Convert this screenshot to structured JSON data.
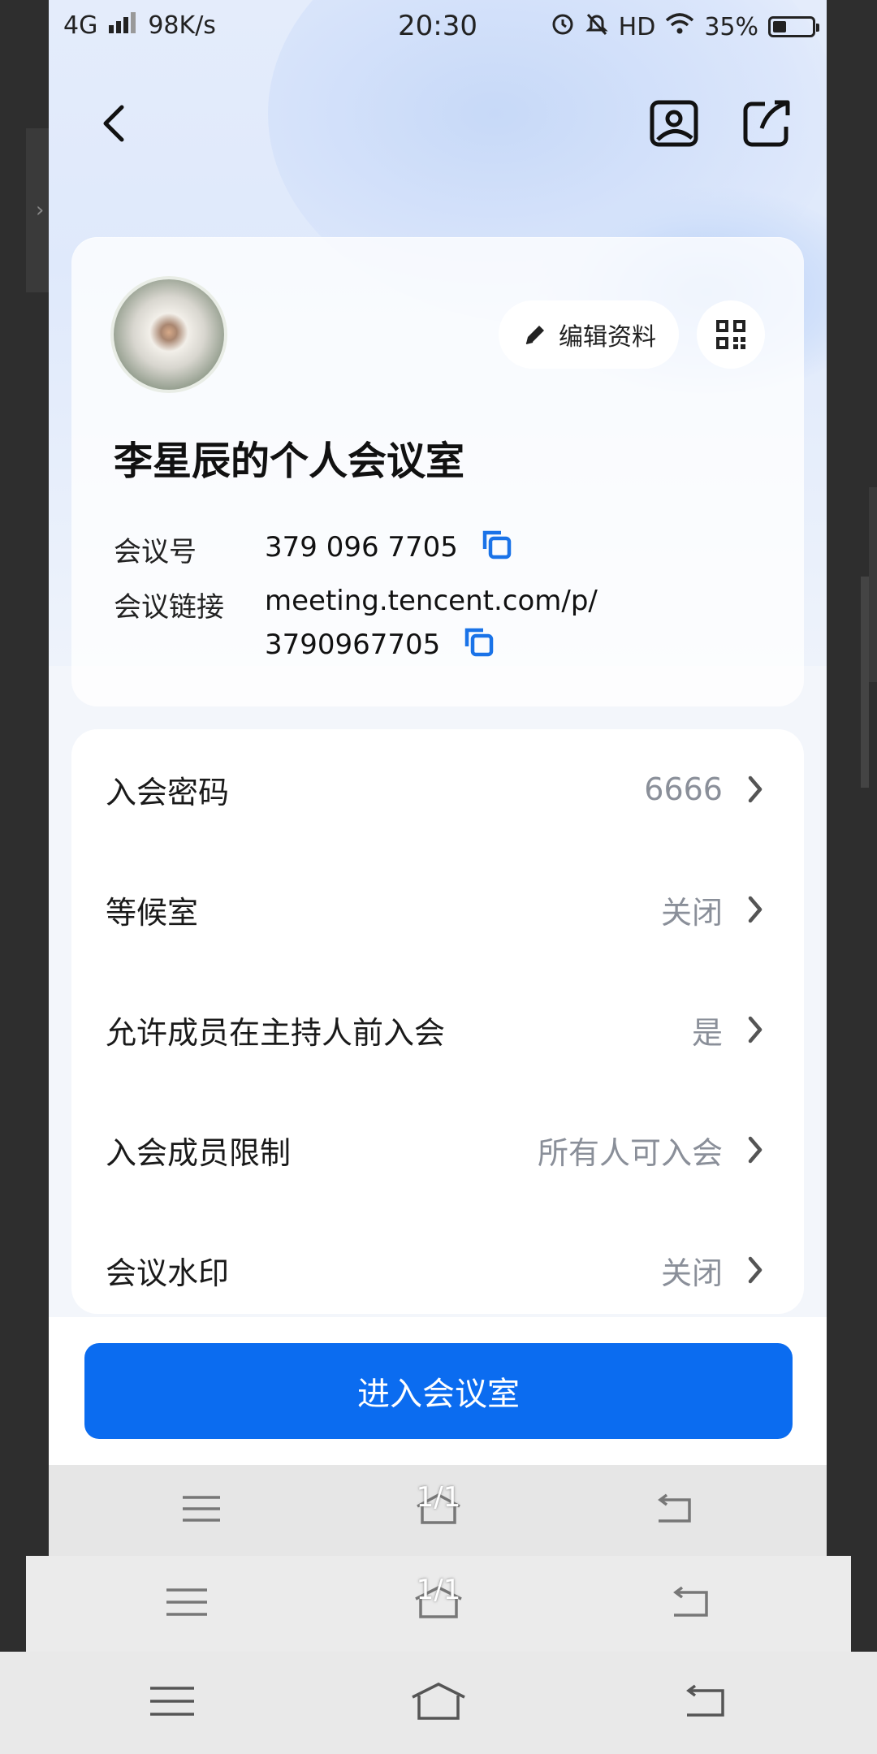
{
  "status_bar": {
    "network": "4G",
    "speed": "98K/s",
    "time": "20:30",
    "hd": "HD",
    "battery": "35%",
    "battery_level": 0.35
  },
  "nav": {
    "back_icon": "back-arrow-icon",
    "background_icon": "image-icon",
    "share_icon": "share-icon"
  },
  "profile": {
    "edit_label": "编辑资料",
    "title": "李星辰的个人会议室",
    "meeting_id_label": "会议号",
    "meeting_id": "379 096 7705",
    "meeting_link_label": "会议链接",
    "meeting_link_line1": "meeting.tencent.com/p/",
    "meeting_link_line2": "3790967705"
  },
  "settings": [
    {
      "label": "入会密码",
      "value": "6666"
    },
    {
      "label": "等候室",
      "value": "关闭"
    },
    {
      "label": "允许成员在主持人前入会",
      "value": "是"
    },
    {
      "label": "入会成员限制",
      "value": "所有人可入会"
    },
    {
      "label": "会议水印",
      "value": "关闭"
    }
  ],
  "enter_button": "进入会议室",
  "page_indicator": "1/1",
  "colors": {
    "accent": "#0b6cf0",
    "copy_icon": "#1a73e8",
    "value_gray": "#8a8f99"
  }
}
